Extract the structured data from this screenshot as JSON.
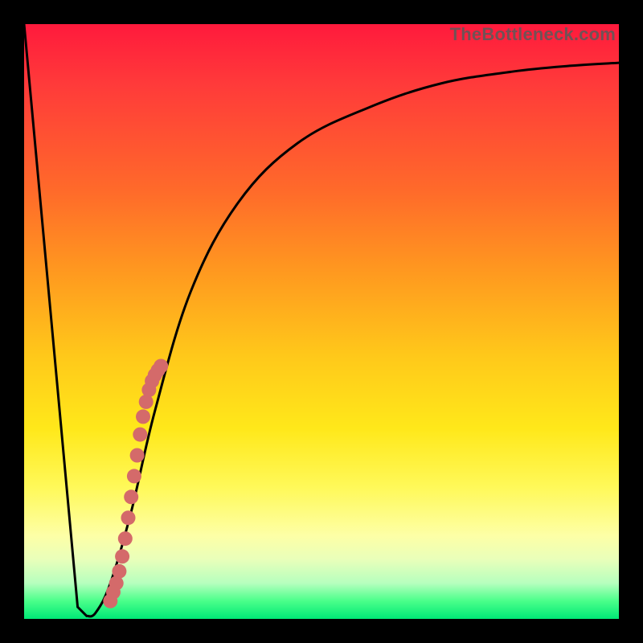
{
  "watermark": "TheBottleneck.com",
  "colors": {
    "curve_stroke": "#000000",
    "dot_fill": "#d46a6a",
    "gradient_stops": [
      "#ff1a3c",
      "#ff3a3a",
      "#ff6a2a",
      "#ff9a1f",
      "#ffc91a",
      "#ffe81a",
      "#fff95a",
      "#fdffa6",
      "#e9ffba",
      "#b6ffbe",
      "#4aff8a",
      "#00e876"
    ]
  },
  "chart_data": {
    "type": "line",
    "title": "",
    "xlabel": "",
    "ylabel": "",
    "xlim": [
      0,
      100
    ],
    "ylim": [
      0,
      100
    ],
    "curve": {
      "x": [
        0,
        9,
        10.5,
        12,
        14.5,
        18,
        22,
        28,
        36,
        46,
        58,
        70,
        82,
        92,
        100
      ],
      "y": [
        100,
        2,
        0.5,
        1,
        6,
        18,
        35,
        55,
        70,
        80,
        86,
        90,
        92,
        93,
        93.5
      ]
    },
    "series": [
      {
        "name": "dots",
        "x": [
          14.5,
          15.0,
          15.5,
          16.0,
          16.5,
          17.0,
          17.5,
          18.0,
          18.5,
          19.0,
          19.5,
          20.0,
          20.5,
          21.0,
          21.5,
          22.0,
          22.5,
          23.0
        ],
        "y": [
          3.0,
          4.5,
          6.0,
          8.0,
          10.5,
          13.5,
          17.0,
          20.5,
          24.0,
          27.5,
          31.0,
          34.0,
          36.5,
          38.5,
          40.0,
          41.0,
          41.8,
          42.5
        ]
      }
    ]
  }
}
